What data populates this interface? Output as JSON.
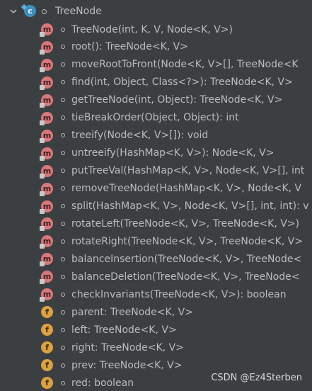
{
  "node": {
    "label": "TreeNode",
    "icon": "class-icon",
    "expanded": true
  },
  "members": [
    {
      "kind": "m",
      "label": "TreeNode(int, K, V, Node<K, V>)"
    },
    {
      "kind": "m",
      "label": "root(): TreeNode<K, V>"
    },
    {
      "kind": "m",
      "label": "moveRootToFront(Node<K, V>[], TreeNode<K"
    },
    {
      "kind": "m",
      "label": "find(int, Object, Class<?>): TreeNode<K, V>"
    },
    {
      "kind": "m",
      "label": "getTreeNode(int, Object): TreeNode<K, V>"
    },
    {
      "kind": "m",
      "label": "tieBreakOrder(Object, Object): int"
    },
    {
      "kind": "m",
      "label": "treeify(Node<K, V>[]): void"
    },
    {
      "kind": "m",
      "label": "untreeify(HashMap<K, V>): Node<K, V>"
    },
    {
      "kind": "m",
      "label": "putTreeVal(HashMap<K, V>, Node<K, V>[], int"
    },
    {
      "kind": "m",
      "label": "removeTreeNode(HashMap<K, V>, Node<K, V"
    },
    {
      "kind": "m",
      "label": "split(HashMap<K, V>, Node<K, V>[], int, int): v"
    },
    {
      "kind": "m",
      "label": "rotateLeft(TreeNode<K, V>, TreeNode<K, V>)"
    },
    {
      "kind": "m",
      "label": "rotateRight(TreeNode<K, V>, TreeNode<K, V>"
    },
    {
      "kind": "m",
      "label": "balanceInsertion(TreeNode<K, V>, TreeNode<"
    },
    {
      "kind": "m",
      "label": "balanceDeletion(TreeNode<K, V>, TreeNode<"
    },
    {
      "kind": "m",
      "label": "checkInvariants(TreeNode<K, V>): boolean"
    },
    {
      "kind": "f",
      "label": "parent: TreeNode<K, V>"
    },
    {
      "kind": "f",
      "label": "left: TreeNode<K, V>"
    },
    {
      "kind": "f",
      "label": "right: TreeNode<K, V>"
    },
    {
      "kind": "f",
      "label": "prev: TreeNode<K, V>"
    },
    {
      "kind": "f",
      "label": "red: boolean"
    }
  ],
  "icon_letters": {
    "m": "m",
    "f": "f",
    "c": "c"
  },
  "watermark": "CSDN @Ez4Sterben",
  "colors": {
    "background": "#3c3f41",
    "text": "#bbbbbb",
    "method_icon": "#d9777a",
    "field_icon": "#dba140",
    "class_icon": "#3d8fbd"
  }
}
